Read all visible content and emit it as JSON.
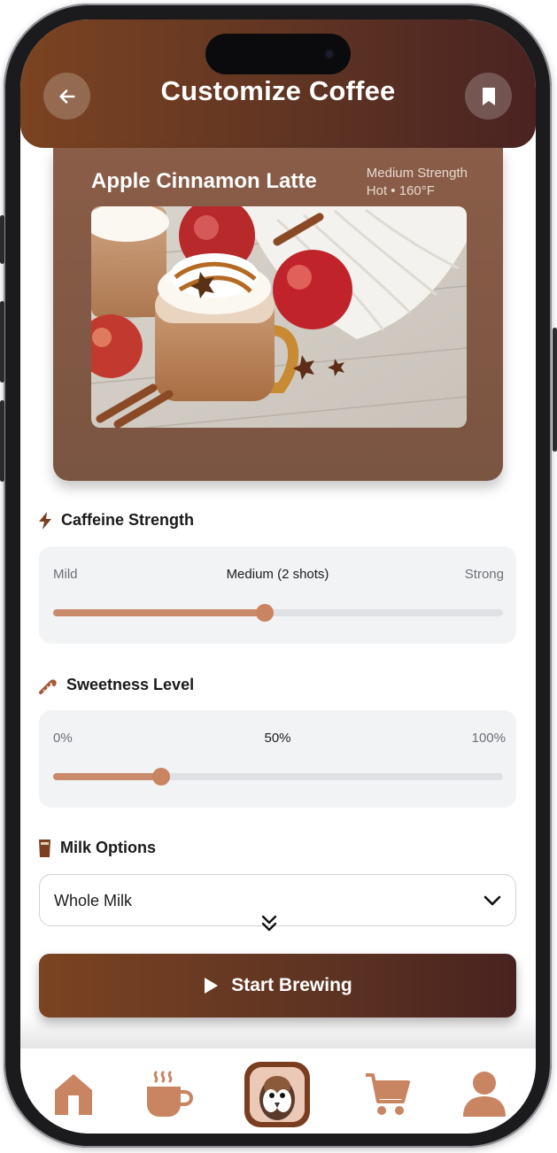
{
  "header": {
    "title": "Customize Coffee",
    "back_icon": "arrow-left-icon",
    "bookmark_icon": "bookmark-icon"
  },
  "coffee": {
    "name": "Apple Cinnamon Latte",
    "strength": "Medium Strength",
    "temperature": "Hot • 160°F",
    "image_icon": "latte-photo"
  },
  "caffeine": {
    "heading": "Caffeine Strength",
    "icon": "bolt-icon",
    "min_label": "Mild",
    "value_label": "Medium (2 shots)",
    "max_label": "Strong",
    "level": 0.47
  },
  "sweetness": {
    "heading": "Sweetness Level",
    "icon": "candy-cane-icon",
    "min_label": "0%",
    "value_label": "50%",
    "max_label": "100%",
    "level": 0.24
  },
  "milk": {
    "heading": "Milk Options",
    "icon": "milk-glass-icon",
    "selected": "Whole Milk",
    "dropdown_icon": "chevron-down-icon",
    "scroll_hint_icon": "double-chevron-down-icon"
  },
  "action": {
    "label": "Start Brewing",
    "icon": "play-icon"
  },
  "nav": {
    "items": [
      "home-icon",
      "coffee-cup-icon",
      "avatar",
      "cart-icon",
      "profile-icon"
    ]
  },
  "colors": {
    "accent": "#c98462",
    "header_dark": "#4a2321",
    "header_light": "#7b4321"
  }
}
